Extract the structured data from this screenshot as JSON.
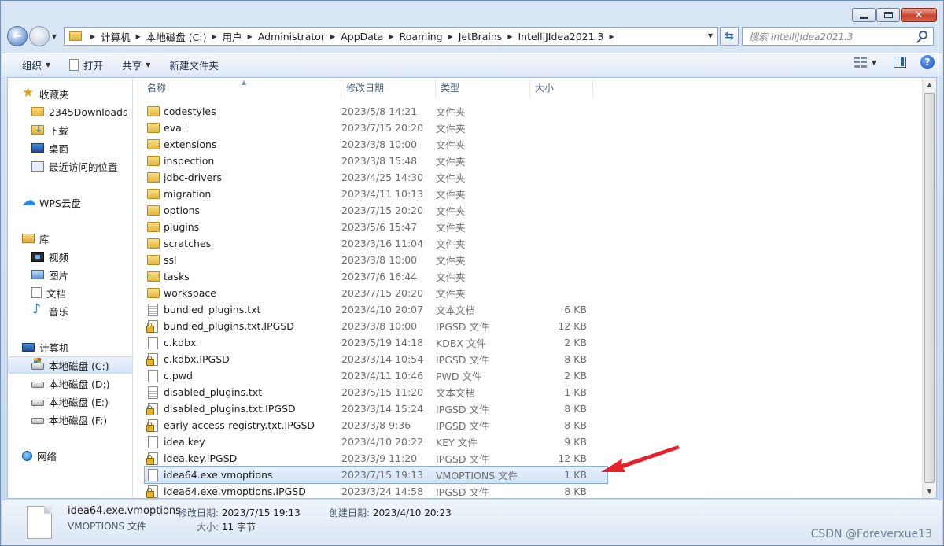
{
  "window": {
    "caption_buttons": [
      "minimize",
      "maximize",
      "close"
    ]
  },
  "address_bar": {
    "breadcrumbs": [
      "计算机",
      "本地磁盘 (C:)",
      "用户",
      "Administrator",
      "AppData",
      "Roaming",
      "JetBrains",
      "IntelliJIdea2021.3"
    ]
  },
  "search": {
    "placeholder": "搜索 IntelliJIdea2021.3"
  },
  "toolbar": {
    "organize": "组织",
    "open": "打开",
    "share": "共享",
    "new_folder": "新建文件夹"
  },
  "sidebar": {
    "items": [
      {
        "label": "收藏夹",
        "icon": "star-icon"
      },
      {
        "label": "2345Downloads",
        "icon": "folder-icon"
      },
      {
        "label": "下载",
        "icon": "downloads-icon"
      },
      {
        "label": "桌面",
        "icon": "desktop-icon"
      },
      {
        "label": "最近访问的位置",
        "icon": "recent-places-icon"
      },
      {
        "label": "WPS云盘",
        "icon": "cloud-icon"
      },
      {
        "label": "库",
        "icon": "library-icon"
      },
      {
        "label": "视频",
        "icon": "video-icon"
      },
      {
        "label": "图片",
        "icon": "pictures-icon"
      },
      {
        "label": "文档",
        "icon": "documents-icon"
      },
      {
        "label": "音乐",
        "icon": "music-icon"
      },
      {
        "label": "计算机",
        "icon": "computer-icon"
      },
      {
        "label": "本地磁盘 (C:)",
        "icon": "drive-c-icon"
      },
      {
        "label": "本地磁盘 (D:)",
        "icon": "drive-icon"
      },
      {
        "label": "本地磁盘 (E:)",
        "icon": "drive-icon"
      },
      {
        "label": "本地磁盘 (F:)",
        "icon": "drive-icon"
      },
      {
        "label": "网络",
        "icon": "network-icon"
      }
    ]
  },
  "columns": {
    "name": "名称",
    "date": "修改日期",
    "type": "类型",
    "size": "大小"
  },
  "files": [
    {
      "name": "codestyles",
      "date": "2023/5/8 14:21",
      "type": "文件夹",
      "size": "",
      "icon": "folder"
    },
    {
      "name": "eval",
      "date": "2023/7/15 20:20",
      "type": "文件夹",
      "size": "",
      "icon": "folder"
    },
    {
      "name": "extensions",
      "date": "2023/3/8 10:00",
      "type": "文件夹",
      "size": "",
      "icon": "folder"
    },
    {
      "name": "inspection",
      "date": "2023/3/8 15:48",
      "type": "文件夹",
      "size": "",
      "icon": "folder"
    },
    {
      "name": "jdbc-drivers",
      "date": "2023/4/25 14:30",
      "type": "文件夹",
      "size": "",
      "icon": "folder"
    },
    {
      "name": "migration",
      "date": "2023/4/11 10:13",
      "type": "文件夹",
      "size": "",
      "icon": "folder"
    },
    {
      "name": "options",
      "date": "2023/7/15 20:20",
      "type": "文件夹",
      "size": "",
      "icon": "folder"
    },
    {
      "name": "plugins",
      "date": "2023/5/6 15:47",
      "type": "文件夹",
      "size": "",
      "icon": "folder"
    },
    {
      "name": "scratches",
      "date": "2023/3/16 11:04",
      "type": "文件夹",
      "size": "",
      "icon": "folder"
    },
    {
      "name": "ssl",
      "date": "2023/3/8 10:00",
      "type": "文件夹",
      "size": "",
      "icon": "folder"
    },
    {
      "name": "tasks",
      "date": "2023/7/6 16:44",
      "type": "文件夹",
      "size": "",
      "icon": "folder"
    },
    {
      "name": "workspace",
      "date": "2023/7/15 20:20",
      "type": "文件夹",
      "size": "",
      "icon": "folder"
    },
    {
      "name": "bundled_plugins.txt",
      "date": "2023/4/10 20:07",
      "type": "文本文档",
      "size": "6 KB",
      "icon": "txt"
    },
    {
      "name": "bundled_plugins.txt.IPGSD",
      "date": "2023/3/8 10:00",
      "type": "IPGSD 文件",
      "size": "12 KB",
      "icon": "locked"
    },
    {
      "name": "c.kdbx",
      "date": "2023/5/19 14:18",
      "type": "KDBX 文件",
      "size": "2 KB",
      "icon": "file"
    },
    {
      "name": "c.kdbx.IPGSD",
      "date": "2023/3/14 10:54",
      "type": "IPGSD 文件",
      "size": "8 KB",
      "icon": "locked"
    },
    {
      "name": "c.pwd",
      "date": "2023/4/11 10:46",
      "type": "PWD 文件",
      "size": "2 KB",
      "icon": "file"
    },
    {
      "name": "disabled_plugins.txt",
      "date": "2023/5/15 11:20",
      "type": "文本文档",
      "size": "1 KB",
      "icon": "txt"
    },
    {
      "name": "disabled_plugins.txt.IPGSD",
      "date": "2023/3/14 15:24",
      "type": "IPGSD 文件",
      "size": "8 KB",
      "icon": "locked"
    },
    {
      "name": "early-access-registry.txt.IPGSD",
      "date": "2023/3/8 9:36",
      "type": "IPGSD 文件",
      "size": "8 KB",
      "icon": "locked"
    },
    {
      "name": "idea.key",
      "date": "2023/4/10 20:22",
      "type": "KEY 文件",
      "size": "9 KB",
      "icon": "file"
    },
    {
      "name": "idea.key.IPGSD",
      "date": "2023/3/9 11:20",
      "type": "IPGSD 文件",
      "size": "12 KB",
      "icon": "locked"
    },
    {
      "name": "idea64.exe.vmoptions",
      "date": "2023/7/15 19:13",
      "type": "VMOPTIONS 文件",
      "size": "1 KB",
      "icon": "file",
      "selected": true
    },
    {
      "name": "idea64.exe.vmoptions.IPGSD",
      "date": "2023/3/24 14:58",
      "type": "IPGSD 文件",
      "size": "8 KB",
      "icon": "locked"
    }
  ],
  "details": {
    "name": "idea64.exe.vmoptions",
    "type": "VMOPTIONS 文件",
    "modified_label": "修改日期:",
    "modified_value": "2023/7/15 19:13",
    "created_label": "创建日期:",
    "created_value": "2023/4/10 20:23",
    "size_label": "大小:",
    "size_value": "11 字节"
  },
  "watermark": "CSDN @Foreverxue13",
  "annotation_color": "#e8202a"
}
